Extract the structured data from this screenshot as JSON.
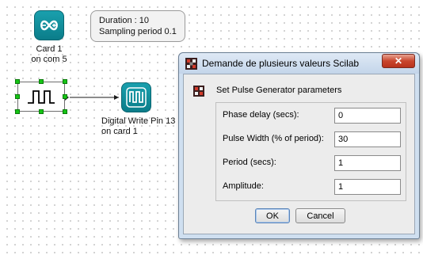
{
  "diagram": {
    "card_block": {
      "label_line1": "Card 1",
      "label_line2": "on com 5",
      "icon": "infinity-logo-icon"
    },
    "note": {
      "line1": "Duration : 10",
      "line2": "Sampling period 0.1"
    },
    "pulse_block": {
      "icon": "pulse-waveform-icon"
    },
    "digital_write_block": {
      "label_line1": "Digital Write Pin 13",
      "label_line2": "on card 1",
      "icon": "digital-write-icon"
    }
  },
  "dialog": {
    "title": "Demande de plusieurs valeurs Scilab",
    "close_label": "✕",
    "header": "Set Pulse Generator parameters",
    "fields": [
      {
        "label": "Phase delay (secs):",
        "value": "0"
      },
      {
        "label": "Pulse Width (% of period):",
        "value": "30"
      },
      {
        "label": "Period (secs):",
        "value": "1"
      },
      {
        "label": "Amplitude:",
        "value": "1"
      }
    ],
    "ok_label": "OK",
    "cancel_label": "Cancel"
  },
  "colors": {
    "block_teal": "#1aa0ae",
    "selection_handle": "#16c416",
    "close_button_red": "#c9462e",
    "dialog_frame": "#cfdff0"
  }
}
